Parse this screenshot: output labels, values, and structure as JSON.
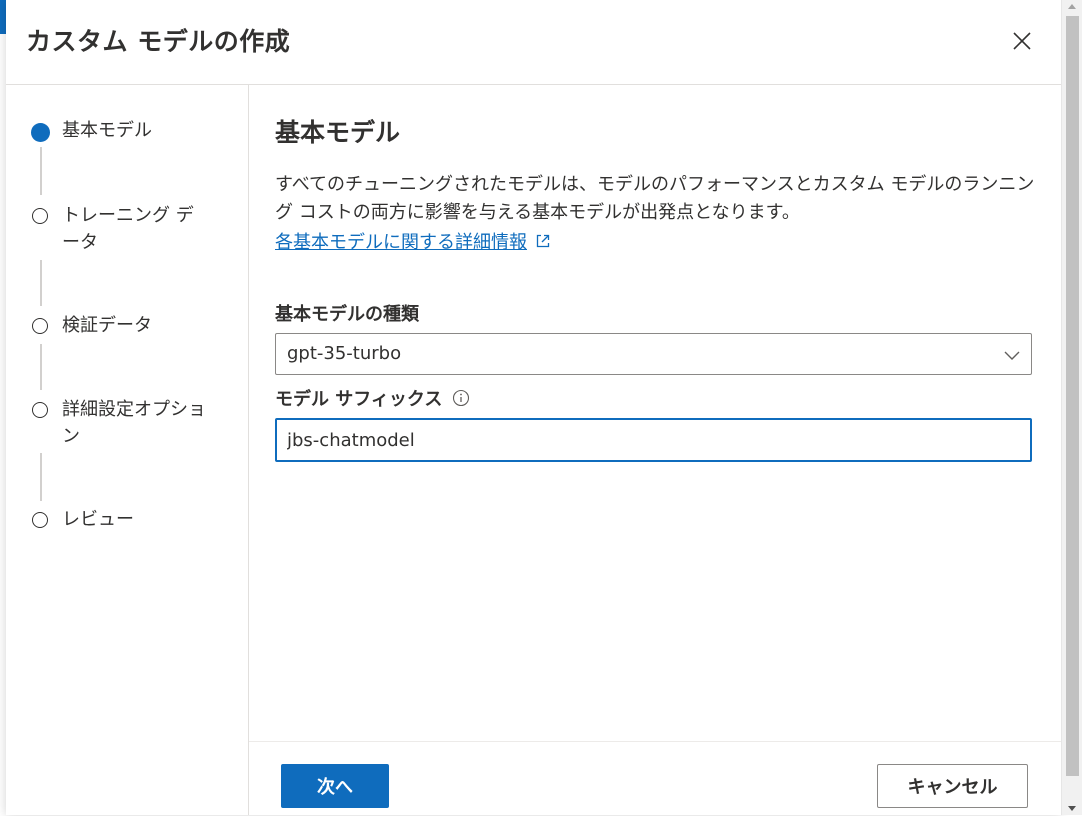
{
  "dialog": {
    "title": "カスタム モデルの作成",
    "close_icon": "close-icon"
  },
  "steps": [
    {
      "label": "基本モデル",
      "state": "active"
    },
    {
      "label": "トレーニング データ",
      "state": "pending"
    },
    {
      "label": "検証データ",
      "state": "pending"
    },
    {
      "label": "詳細設定オプション",
      "state": "pending"
    },
    {
      "label": "レビュー",
      "state": "pending"
    }
  ],
  "content": {
    "heading": "基本モデル",
    "description": "すべてのチューニングされたモデルは、モデルのパフォーマンスとカスタム モデルのランニング コストの両方に影響を与える基本モデルが出発点となります。",
    "learn_more_link": "各基本モデルに関する詳細情報",
    "base_model_label": "基本モデルの種類",
    "base_model_value": "gpt-35-turbo",
    "suffix_label": "モデル サフィックス",
    "suffix_value": "jbs-chatmodel"
  },
  "footer": {
    "next_label": "次へ",
    "cancel_label": "キャンセル"
  },
  "colors": {
    "accent": "#0f6cbd",
    "text": "#323130",
    "border": "#8a8886"
  }
}
